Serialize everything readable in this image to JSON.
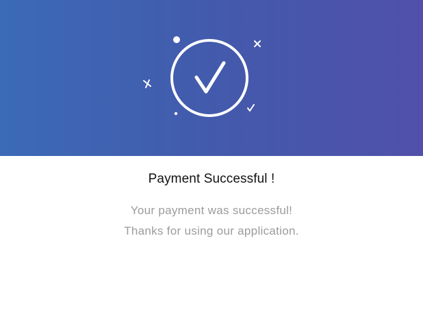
{
  "banner": {
    "icon": "check-circle-icon",
    "decorations": [
      "dot-icon",
      "cross-icon",
      "cross-icon",
      "small-dot-icon",
      "small-check-icon"
    ],
    "gradient_start": "#3b6ab6",
    "gradient_end": "#5050aa"
  },
  "title": "Payment Successful !",
  "message": {
    "line1": "Your payment was successful!",
    "line2": "Thanks for using our application."
  },
  "colors": {
    "title": "#111111",
    "message": "#9b9b9b",
    "icon": "#ffffff"
  }
}
